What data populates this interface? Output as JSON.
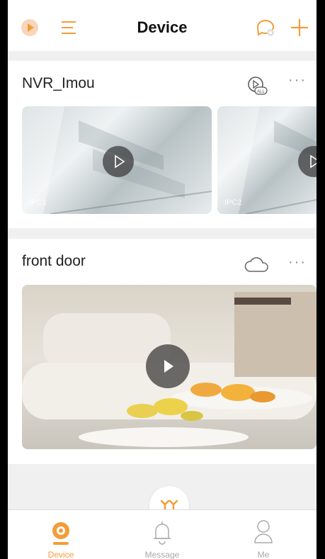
{
  "header": {
    "title": "Device"
  },
  "devices": [
    {
      "name": "NVR_Imou",
      "channels": [
        {
          "label": "IPC1"
        },
        {
          "label": "IPC2"
        }
      ]
    },
    {
      "name": "front door"
    }
  ],
  "more_label": "···",
  "tabs": [
    {
      "label": "Device",
      "active": true
    },
    {
      "label": "Message",
      "active": false
    },
    {
      "label": "Me",
      "active": false
    }
  ],
  "colors": {
    "accent": "#f29d38",
    "bg": "#f0f0f0"
  }
}
